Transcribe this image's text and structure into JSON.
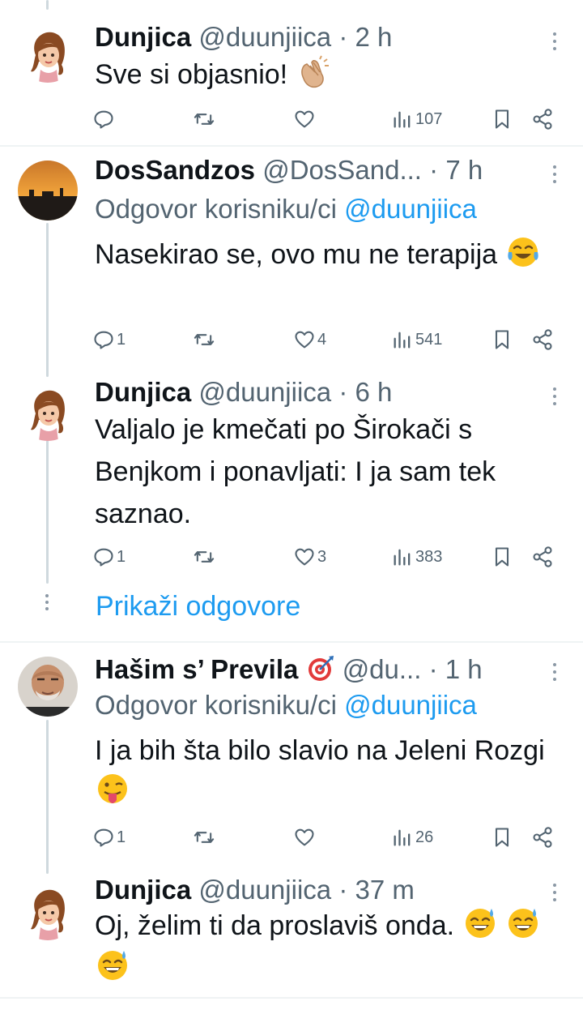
{
  "tweets": [
    {
      "name": "Dunjica",
      "handle": "@duunjiica",
      "dot": "·",
      "time": "2 h",
      "replying": null,
      "text": "Sve si objasnio!",
      "emoji": [
        "clapping-hands"
      ],
      "counts": {
        "replies": "",
        "retweets": "",
        "likes": "",
        "views": "107"
      }
    },
    {
      "name": "DosSandzos",
      "handle": "@DosSand...",
      "dot": "·",
      "time": "7 h",
      "replying": {
        "prefix": "Odgovor korisniku/ci",
        "mention": "@duunjiica"
      },
      "text": "Nasekirao se, ovo mu ne terapija",
      "emoji": [
        "tears-of-joy"
      ],
      "counts": {
        "replies": "1",
        "retweets": "",
        "likes": "4",
        "views": "541"
      }
    },
    {
      "name": "Dunjica",
      "handle": "@duunjiica",
      "dot": "·",
      "time": "6 h",
      "replying": null,
      "text": "Valjalo je kmečati po Širokači s Benjkom i ponavljati: I ja sam tek saznao.",
      "emoji": [],
      "counts": {
        "replies": "1",
        "retweets": "",
        "likes": "3",
        "views": "383"
      }
    },
    {
      "name": "Hašim s’ Previla",
      "handle": "@du...",
      "dot": "·",
      "time": "1 h",
      "replying": {
        "prefix": "Odgovor korisniku/ci",
        "mention": "@duunjiica"
      },
      "text": "I ja bih šta bilo slavio na Jeleni Rozgi",
      "emoji": [
        "tongue-out"
      ],
      "counts": {
        "replies": "1",
        "retweets": "",
        "likes": "",
        "views": "26"
      }
    },
    {
      "name": "Dunjica",
      "handle": "@duunjiica",
      "dot": "·",
      "time": "37 m",
      "replying": null,
      "text": "Oj, želim ti da proslaviš onda.",
      "emoji": [
        "sweat-smile",
        "sweat-smile",
        "sweat-smile"
      ],
      "counts": {
        "replies": "",
        "retweets": "",
        "likes": "",
        "views": ""
      }
    }
  ],
  "show_replies": "Prikaži odgovore",
  "icons": {
    "reply": "reply-icon",
    "retweet": "retweet-icon",
    "like": "heart-icon",
    "views": "views-icon",
    "bookmark": "bookmark-icon",
    "share": "share-icon",
    "more": "more-vertical-icon",
    "name_badge": "target-icon"
  },
  "colors": {
    "link": "#1d9bf0",
    "muted": "#536471",
    "text": "#0f1419",
    "line": "#cfd9de"
  }
}
